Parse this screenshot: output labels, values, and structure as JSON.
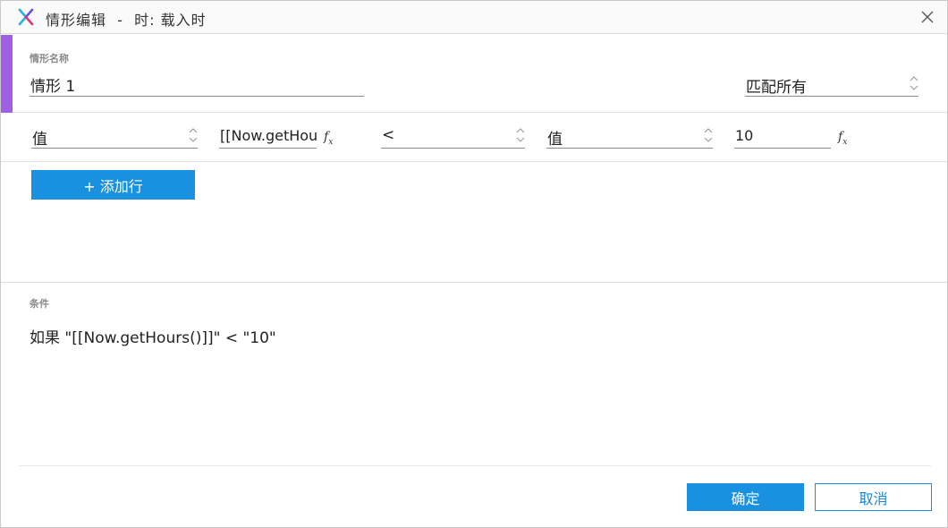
{
  "window": {
    "title": "情形编辑  -  时: 载入时",
    "close_icon": "close-icon",
    "app_icon": "axure-logo-icon"
  },
  "case_name": {
    "label": "情形名称",
    "value": "情形 1",
    "match_select": "匹配所有"
  },
  "condition_row": {
    "left_type": "值",
    "left_value": "[[Now.getHou",
    "operator": "<",
    "right_type": "值",
    "right_value": "10",
    "fx_label": "f",
    "fx_sub": "x"
  },
  "add_row_label": "+ 添加行",
  "conditions": {
    "label": "条件",
    "text": "如果 \"[[Now.getHours()]]\" < \"10\""
  },
  "footer": {
    "ok_label": "确定",
    "cancel_label": "取消"
  },
  "colors": {
    "accent": "#a15ee6",
    "primary": "#1a90e0"
  }
}
